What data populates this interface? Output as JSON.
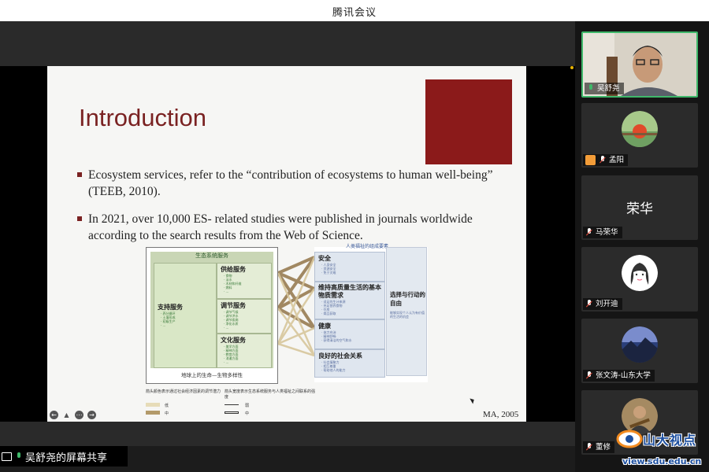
{
  "window": {
    "title": "腾讯会议"
  },
  "slide": {
    "title": "Introduction",
    "bullets": [
      "Ecosystem services, refer to the “contribution of ecosystems to human well-being” (TEEB, 2010).",
      "In 2021, over 10,000 ES- related studies were published in journals worldwide according to the search results from the Web of Science."
    ],
    "source": "MA, 2005",
    "diagram": {
      "left_header": "生态系统服务",
      "support": "支持服务",
      "support_items": [
        "· 养分循环",
        "· 土壤形成",
        "· 初级生产",
        "· ..."
      ],
      "boxes": [
        {
          "title": "供给服务",
          "items": [
            "· 食物",
            "· 淡水",
            "· 木材和纤维",
            "· 燃料",
            "· ..."
          ]
        },
        {
          "title": "调节服务",
          "items": [
            "· 调节气候",
            "· 调节洪水",
            "· 调节疾病",
            "· 净化水质",
            "· ..."
          ]
        },
        {
          "title": "文化服务",
          "items": [
            "· 美学方面",
            "· 精神方面",
            "· 教育方面",
            "· 消遣方面",
            "· ..."
          ]
        }
      ],
      "left_footer": "地球上的生命—生物多样性",
      "right_header": "人类福祉的组成要素",
      "right_boxes": [
        {
          "title": "安全",
          "items": [
            "· 人身安全",
            "· 资源安全",
            "· 免于灾难"
          ]
        },
        {
          "title": "维持高质量生活的基本物质需求",
          "items": [
            "· 适足的生计来源",
            "· 充足营养食物",
            "· 住房",
            "· 商品获取"
          ]
        },
        {
          "title": "健康",
          "items": [
            "· 体力充沛",
            "· 精神舒畅",
            "· 获得清洁的空气和水"
          ]
        },
        {
          "title": "良好的社会关系",
          "items": [
            "· 社会凝聚力",
            "· 相互尊重",
            "· 帮助他人的能力"
          ]
        }
      ],
      "freedom": "选择与行动的自由",
      "freedom_sub": "能够实现个人认为有价值的生活的机会",
      "legend_arrow_color": "箭头颜色表示通过社会经济因素的调节潜力",
      "legend_arrow_width": "箭头宽度表示生态系统服务与人类福祉之间联系的强度",
      "legend_low": "低",
      "legend_mid": "中",
      "legend_weak": "弱"
    }
  },
  "participants": [
    {
      "name": "吴舒尧",
      "mic": "on",
      "active": true
    },
    {
      "name": "孟阳",
      "mic": "muted",
      "host": true
    },
    {
      "name": "马荣华",
      "mic": "muted",
      "display_text": "荣华"
    },
    {
      "name": "刘开迪",
      "mic": "muted"
    },
    {
      "name": "张文涛-山东大学",
      "mic": "muted"
    },
    {
      "name": "董修",
      "mic": "muted"
    }
  ],
  "share": {
    "label": "吴舒尧的屏幕共享"
  },
  "watermark": {
    "text": "山大视点",
    "url": "view.sdu.edu.cn"
  },
  "colors": {
    "accent_green": "#3fb86a",
    "slide_title": "#7a2222",
    "muted_red": "#e74c3c"
  }
}
